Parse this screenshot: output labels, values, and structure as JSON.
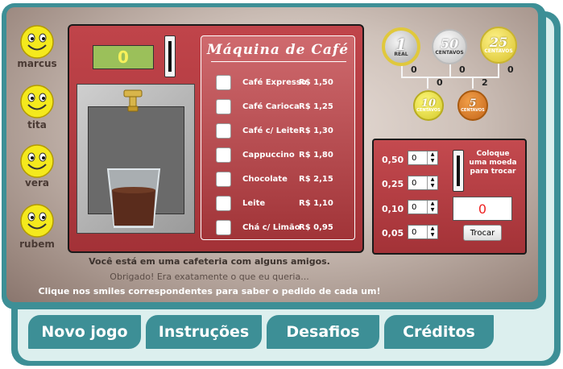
{
  "friends": [
    "marcus",
    "tita",
    "vera",
    "rubem"
  ],
  "machine": {
    "display_value": "0",
    "menu_title": "Máquina de Café",
    "items": [
      {
        "name": "Café Expresso",
        "price": "R$ 1,50"
      },
      {
        "name": "Café Carioca",
        "price": "R$ 1,25"
      },
      {
        "name": "Café c/ Leite",
        "price": "R$ 1,30"
      },
      {
        "name": "Cappuccino",
        "price": "R$ 1,80"
      },
      {
        "name": "Chocolate",
        "price": "R$ 2,15"
      },
      {
        "name": "Leite",
        "price": "R$ 1,10"
      },
      {
        "name": "Chá c/ Limão",
        "price": "R$ 0,95"
      }
    ]
  },
  "messages": {
    "line1": "Você está em uma cafeteria com alguns amigos.",
    "line2": "Obrigado! Era exatamente o que eu queria...",
    "line3": "Clique nos smiles correspondentes para saber o pedido de cada um!"
  },
  "coins": [
    {
      "value": "1",
      "label": "REAL",
      "count": "0",
      "color": "#c9c9c9"
    },
    {
      "value": "50",
      "label": "CENTAVOS",
      "count": "0",
      "color": "#d0d0d0"
    },
    {
      "value": "25",
      "label": "CENTAVOS",
      "count": "0",
      "color": "#e6d24a"
    },
    {
      "value": "10",
      "label": "CENTAVOS",
      "count": "0",
      "color": "#dcd23a"
    },
    {
      "value": "5",
      "label": "CENTAVOS",
      "count": "2",
      "color": "#d9781f"
    }
  ],
  "exchange": {
    "rows": [
      {
        "label": "0,50",
        "value": "0"
      },
      {
        "label": "0,25",
        "value": "0"
      },
      {
        "label": "0,10",
        "value": "0"
      },
      {
        "label": "0,05",
        "value": "0"
      }
    ],
    "message": "Coloque uma moeda para trocar",
    "display_value": "0",
    "button_label": "Trocar"
  },
  "nav": [
    "Novo jogo",
    "Instruções",
    "Desafios",
    "Créditos"
  ]
}
